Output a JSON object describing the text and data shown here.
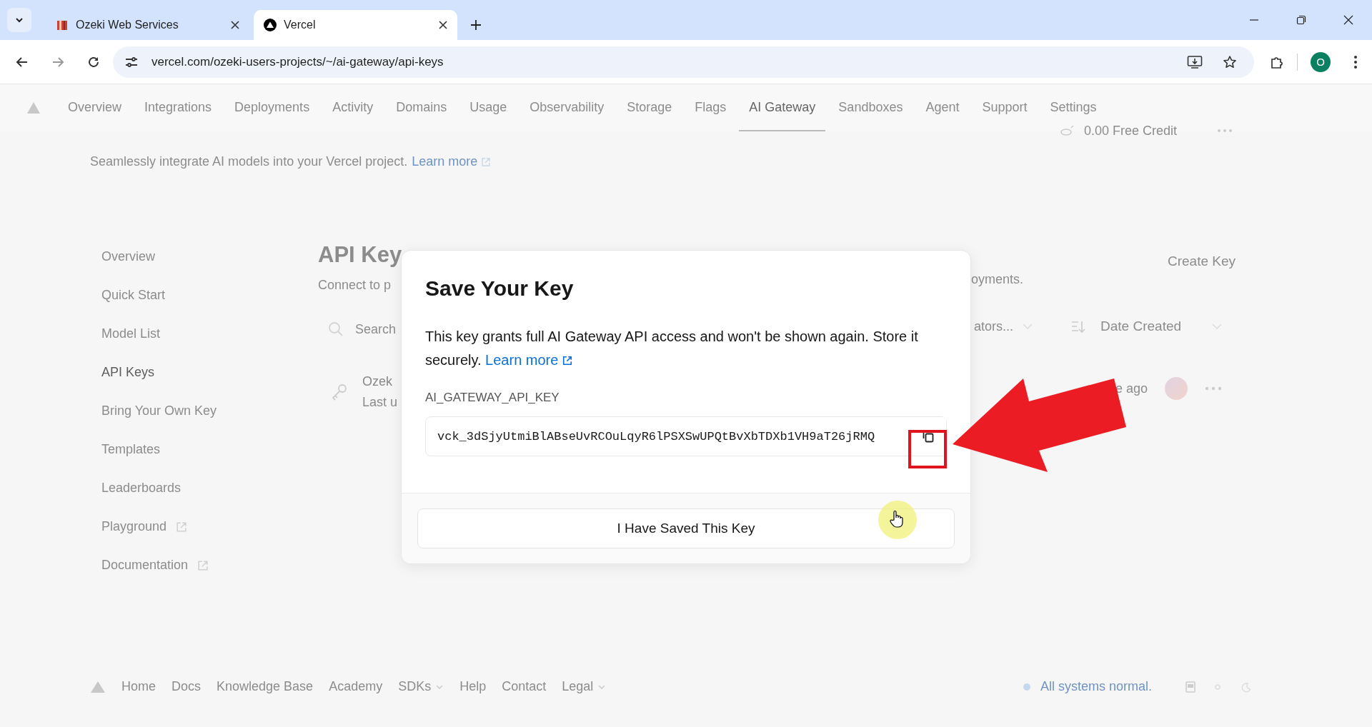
{
  "browser": {
    "tabs": [
      {
        "title": "Ozeki Web Services",
        "selected": false,
        "kind": "ozeki"
      },
      {
        "title": "Vercel",
        "selected": true,
        "kind": "vercel"
      }
    ],
    "url": "vercel.com/ozeki-users-projects/~/ai-gateway/api-keys",
    "profile": "O"
  },
  "nav": [
    {
      "label": "Overview",
      "selected": false
    },
    {
      "label": "Integrations",
      "selected": false
    },
    {
      "label": "Deployments",
      "selected": false
    },
    {
      "label": "Activity",
      "selected": false
    },
    {
      "label": "Domains",
      "selected": false
    },
    {
      "label": "Usage",
      "selected": false
    },
    {
      "label": "Observability",
      "selected": false
    },
    {
      "label": "Storage",
      "selected": false
    },
    {
      "label": "Flags",
      "selected": false
    },
    {
      "label": "AI Gateway",
      "selected": true
    },
    {
      "label": "Sandboxes",
      "selected": false
    },
    {
      "label": "Agent",
      "selected": false
    },
    {
      "label": "Support",
      "selected": false
    },
    {
      "label": "Settings",
      "selected": false
    }
  ],
  "credit": "0.00 Free Credit",
  "subtitle": {
    "text": "Seamlessly integrate AI models into your Vercel project.",
    "link": "Learn more"
  },
  "sidebar": [
    {
      "label": "Overview",
      "selected": false,
      "external": false
    },
    {
      "label": "Quick Start",
      "selected": false,
      "external": false
    },
    {
      "label": "Model List",
      "selected": false,
      "external": false
    },
    {
      "label": "API Keys",
      "selected": true,
      "external": false
    },
    {
      "label": "Bring Your Own Key",
      "selected": false,
      "external": false
    },
    {
      "label": "Templates",
      "selected": false,
      "external": false
    },
    {
      "label": "Leaderboards",
      "selected": false,
      "external": false
    },
    {
      "label": "Playground",
      "selected": false,
      "external": true
    },
    {
      "label": "Documentation",
      "selected": false,
      "external": true
    }
  ],
  "main": {
    "heading": "API Key",
    "description": "Connect to p",
    "search_placeholder": "Search",
    "key_name": "Ozek",
    "key_meta": "Last u",
    "create_button": "Create Key",
    "description_end": "oyments.",
    "filter": "ators...",
    "sort": "Date Created",
    "created": "e ago"
  },
  "dialog": {
    "title": "Save Your Key",
    "body": "This key grants full AI Gateway API access and won't be shown again. Store it securely.",
    "link": "Learn more",
    "key_label": "AI_GATEWAY_API_KEY",
    "key_value": "vck_3dSjyUtmiBlABseUvRCOuLqyR6lPSXSwUPQtBvXbTDXb1VH9aT26jRMQ",
    "button": "I Have Saved This Key"
  },
  "footer": {
    "links": [
      {
        "label": "Home",
        "dropdown": false
      },
      {
        "label": "Docs",
        "dropdown": false
      },
      {
        "label": "Knowledge Base",
        "dropdown": false
      },
      {
        "label": "Academy",
        "dropdown": false
      },
      {
        "label": "SDKs",
        "dropdown": true
      },
      {
        "label": "Help",
        "dropdown": false
      },
      {
        "label": "Contact",
        "dropdown": false
      },
      {
        "label": "Legal",
        "dropdown": true
      }
    ],
    "status": "All systems normal."
  }
}
